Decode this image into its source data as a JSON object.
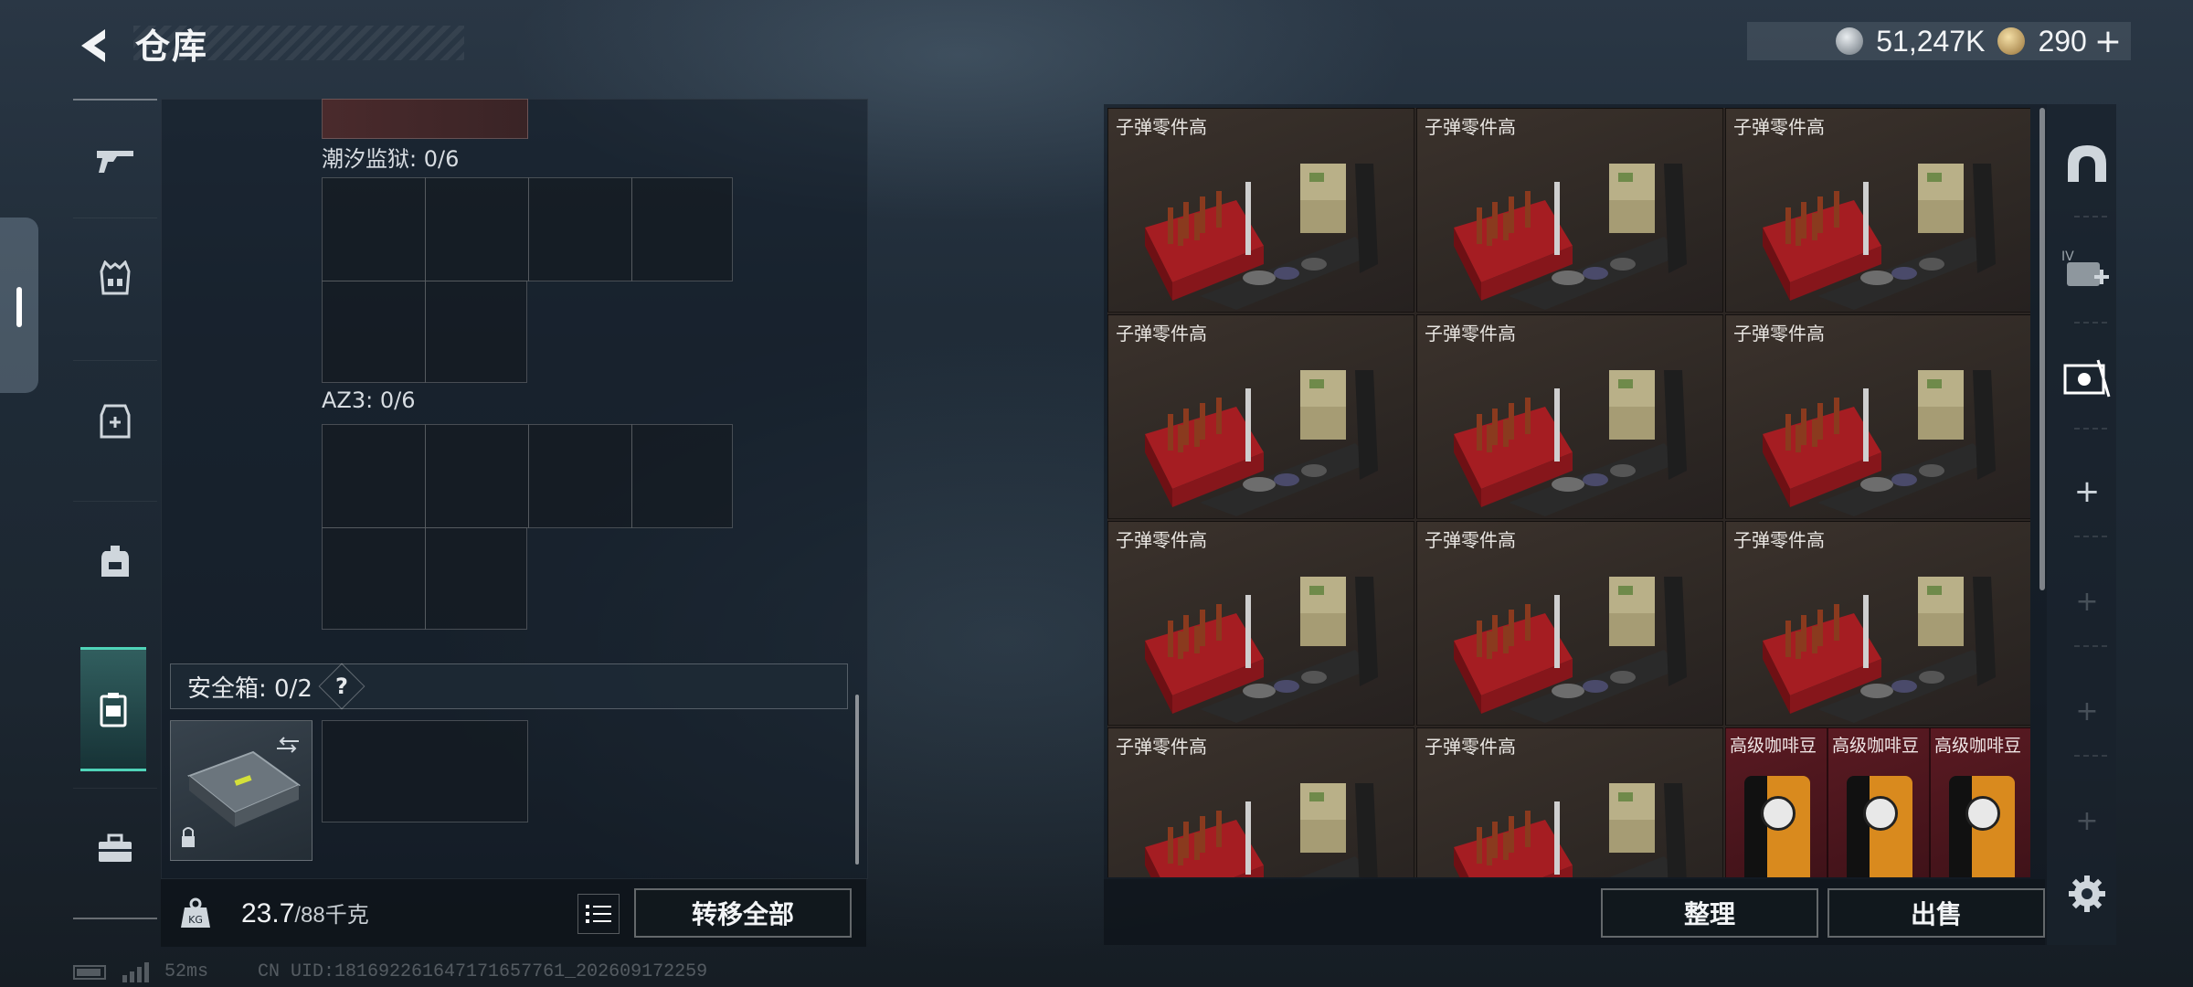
{
  "header": {
    "title": "仓库",
    "currency": [
      {
        "icon": "silver-coin-icon",
        "value": "51,247K"
      },
      {
        "icon": "gold-coin-icon",
        "value": "290"
      }
    ],
    "plus_label": "+"
  },
  "left_nav": {
    "items": [
      {
        "icon": "gun-icon",
        "active": false
      },
      {
        "icon": "vest-icon",
        "active": false
      },
      {
        "icon": "rig-icon",
        "active": false
      },
      {
        "icon": "backpack-icon",
        "active": false
      },
      {
        "icon": "safe-box-icon",
        "active": true
      },
      {
        "icon": "toolbox-icon",
        "active": false
      }
    ]
  },
  "containers": [
    {
      "label": "潮汐监狱: 0/6"
    },
    {
      "label": "AZ3: 0/6"
    }
  ],
  "safe_box": {
    "label": "安全箱: 0/2",
    "help": "?"
  },
  "footer_left": {
    "weight_current": "23.7",
    "weight_max": "/88千克",
    "transfer_all": "转移全部"
  },
  "stash": {
    "ammo_label": "子弹零件高",
    "coffee_label": "高级咖啡豆",
    "ammo_count": 11,
    "coffee_count": 3
  },
  "footer_right": {
    "sort_label": "整理",
    "sell_label": "出售"
  },
  "status_bar": {
    "ping": "52ms",
    "uid": "CN UID:18169226164717165776​1_202609172259"
  },
  "colors": {
    "accent": "#4fd3b8",
    "coffee_bg": "#5a1a22",
    "ammo_bg": "#2e2824"
  }
}
